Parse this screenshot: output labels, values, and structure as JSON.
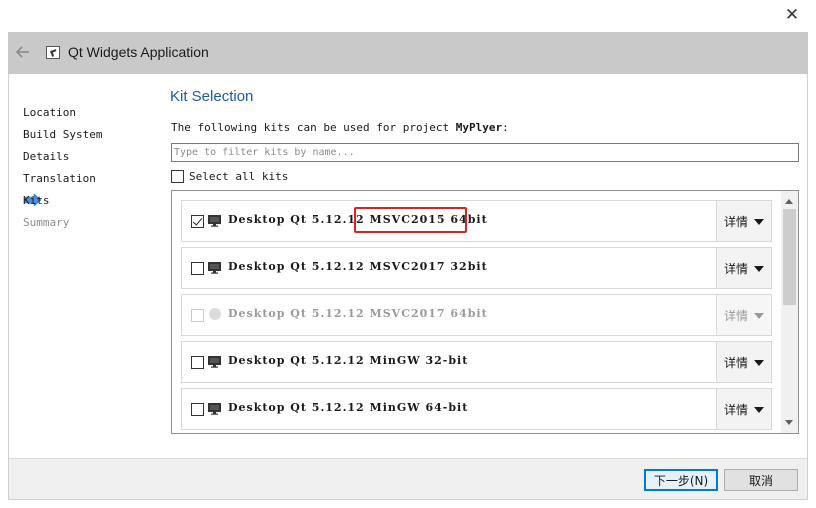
{
  "window": {
    "close_glyph": "✕"
  },
  "header": {
    "title": "Qt Widgets Application",
    "back_icon": "back-arrow-icon",
    "app_icon": "qt-application-icon"
  },
  "sidebar": {
    "items": [
      {
        "label": "Location",
        "state": "done"
      },
      {
        "label": "Build System",
        "state": "done"
      },
      {
        "label": "Details",
        "state": "done"
      },
      {
        "label": "Translation",
        "state": "done"
      },
      {
        "label": "Kits",
        "state": "current"
      },
      {
        "label": "Summary",
        "state": "pending"
      }
    ],
    "current_marker_icon": "current-step-arrow-icon"
  },
  "main": {
    "title": "Kit Selection",
    "intro_prefix": "The following kits can be used for project ",
    "intro_project": "MyPlyer",
    "intro_suffix": ":",
    "filter_placeholder": "Type to filter kits by name...",
    "filter_value": "",
    "select_all_label": "Select all kits",
    "select_all_checked": false
  },
  "kits": [
    {
      "name": "Desktop Qt 5.12.12 MSVC2015 64bit",
      "checked": true,
      "enabled": true,
      "icon": "monitor-icon",
      "details_label": "详情",
      "highlighted": true
    },
    {
      "name": "Desktop Qt 5.12.12 MSVC2017 32bit",
      "checked": false,
      "enabled": true,
      "icon": "monitor-icon",
      "details_label": "详情",
      "highlighted": false
    },
    {
      "name": "Desktop Qt 5.12.12 MSVC2017 64bit",
      "checked": false,
      "enabled": false,
      "icon": "disabled-dot-icon",
      "details_label": "详情",
      "highlighted": false
    },
    {
      "name": "Desktop Qt 5.12.12 MinGW 32-bit",
      "checked": false,
      "enabled": true,
      "icon": "monitor-icon",
      "details_label": "详情",
      "highlighted": false
    },
    {
      "name": "Desktop Qt 5.12.12 MinGW 64-bit",
      "checked": false,
      "enabled": true,
      "icon": "monitor-icon",
      "details_label": "详情",
      "highlighted": false
    }
  ],
  "footer": {
    "next_label": "下一步(N)",
    "cancel_label": "取消"
  },
  "colors": {
    "accent": "#1b5aa7",
    "highlight_box": "#e02020",
    "header_bg": "#c9c9c9",
    "step_arrow": "#4a90e2"
  }
}
